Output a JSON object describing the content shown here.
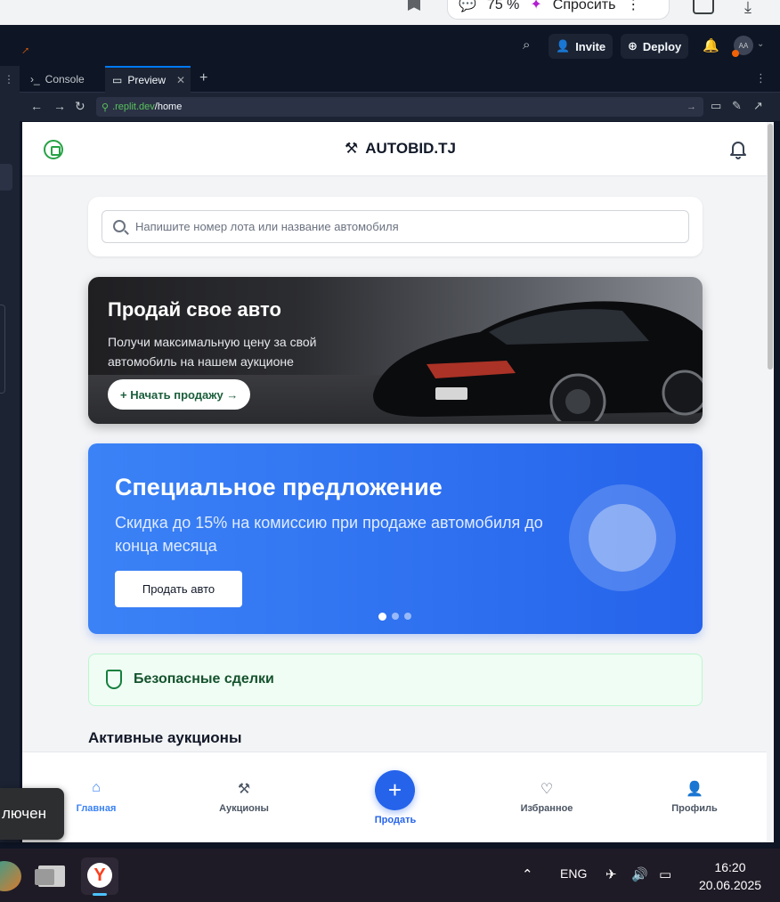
{
  "browser": {
    "zoom": "75 %",
    "ask_label": "Спросить"
  },
  "replit": {
    "invite_label": "Invite",
    "deploy_label": "Deploy",
    "avatar_initials": "AA",
    "tabs": [
      {
        "label": "Console",
        "active": false
      },
      {
        "label": "Preview",
        "active": true
      }
    ],
    "url_host": ".replit.dev",
    "url_path": "/home"
  },
  "app": {
    "brand": "AUTOBID.TJ",
    "search_placeholder": "Напишите номер лота или название автомобиля",
    "sell_banner": {
      "title": "Продай свое авто",
      "subtitle": "Получи максимальную цену за свой автомобиль на нашем аукционе",
      "button": "+ Начать продажу →"
    },
    "promo": {
      "title": "Специальное предложение",
      "subtitle": "Скидка до 15% на комиссию при продаже автомобиля до конца месяца",
      "button": "Продать авто",
      "slides": 3,
      "active_slide": 1
    },
    "safe_deals": "Безопасные сделки",
    "section_title": "Активные аукционы",
    "nav": {
      "home": "Главная",
      "auctions": "Аукционы",
      "sell": "Продать",
      "favorites": "Избранное",
      "profile": "Профиль"
    }
  },
  "toast": "лючен",
  "taskbar": {
    "lang": "ENG",
    "time": "16:20",
    "date": "20.06.2025"
  },
  "colors": {
    "primary": "#2563eb",
    "promo_start": "#3b82f6",
    "success": "#15803d",
    "whatsapp": "#25a244",
    "replit_bg": "#0e1525"
  }
}
